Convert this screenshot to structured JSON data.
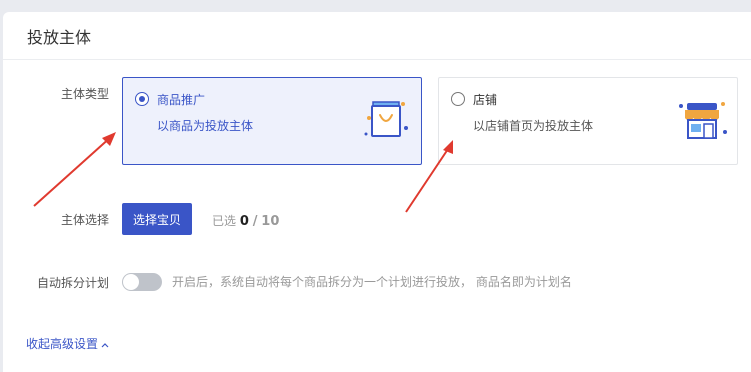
{
  "card": {
    "title": "投放主体"
  },
  "subject_type": {
    "label": "主体类型",
    "options": [
      {
        "title": "商品推广",
        "desc": "以商品为投放主体",
        "icon": "shopping-bag-icon",
        "selected": true
      },
      {
        "title": "店铺",
        "desc": "以店铺首页为投放主体",
        "icon": "storefront-icon",
        "selected": false
      }
    ]
  },
  "subject_select": {
    "label": "主体选择",
    "button_label": "选择宝贝",
    "selected_prefix": "已选",
    "selected_count": "0",
    "separator": "/",
    "total": "10"
  },
  "auto_split": {
    "label": "自动拆分计划",
    "enabled": false,
    "hint": "开启后，系统自动将每个商品拆分为一个计划进行投放， 商品名即为计划名"
  },
  "advanced": {
    "collapse_label": "收起高级设置",
    "icon": "chevron-up-icon"
  },
  "colors": {
    "accent": "#3a55c7",
    "annotation_arrow": "#e03a2f"
  }
}
